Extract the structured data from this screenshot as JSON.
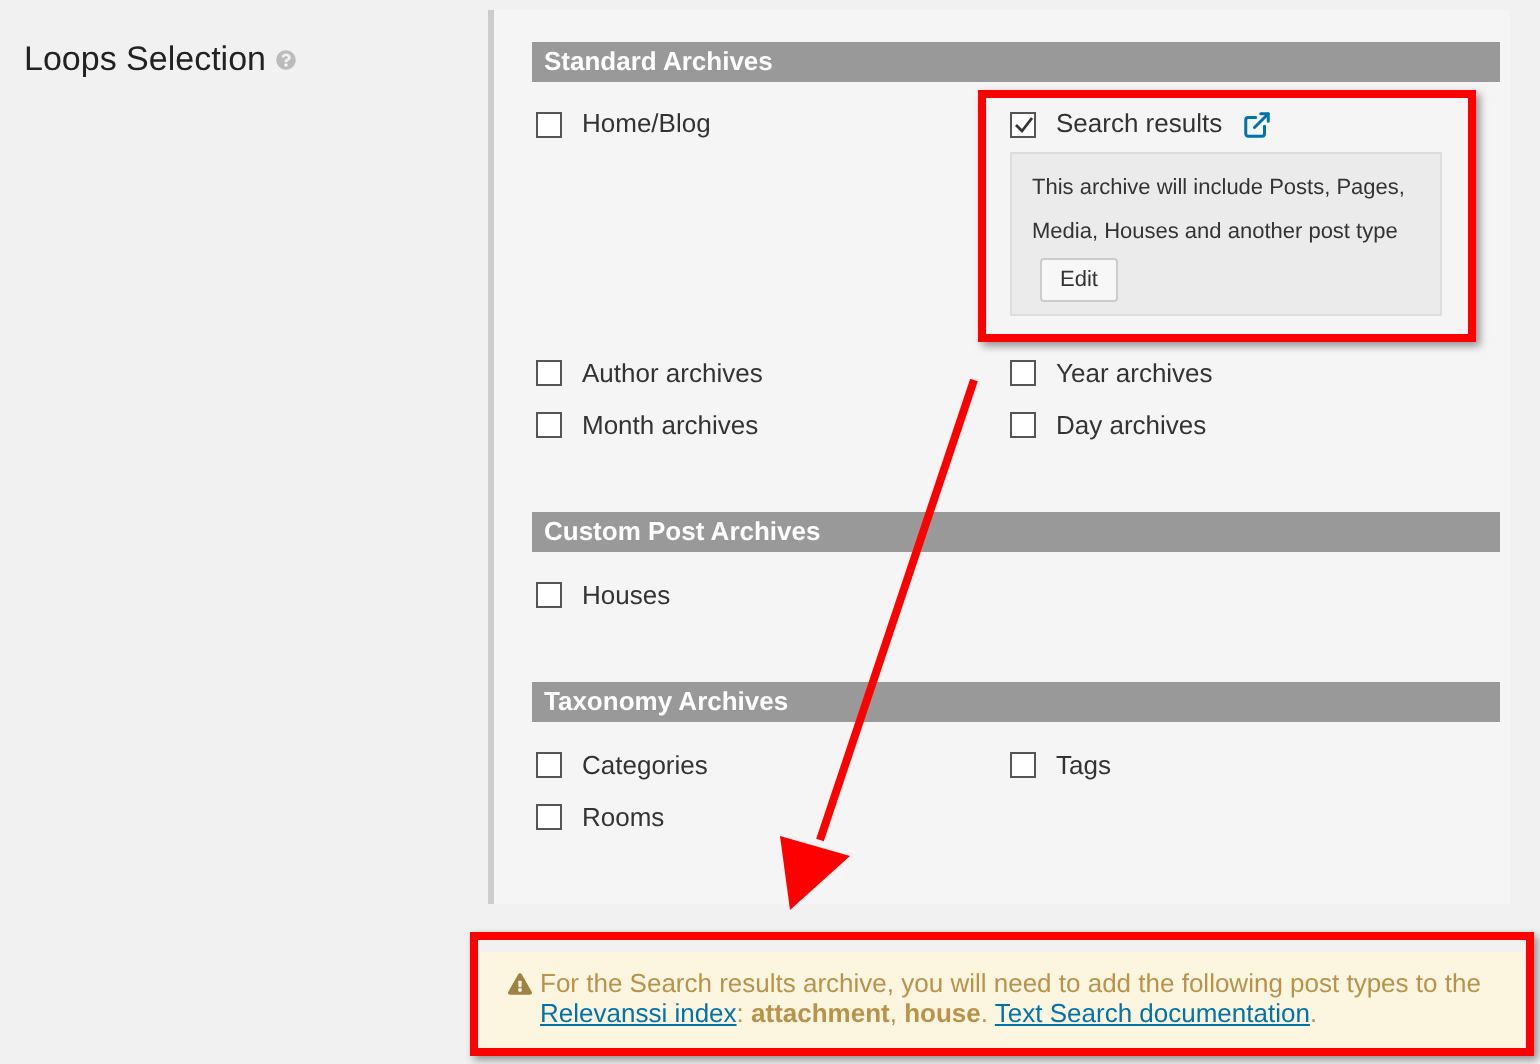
{
  "setting": {
    "label": "Loops Selection"
  },
  "sections": [
    {
      "title": "Standard Archives",
      "items": [
        {
          "label": "Home/Blog",
          "checked": false
        },
        {
          "label": "Search results",
          "checked": true,
          "link": true,
          "note": {
            "text": "This archive will include Posts, Pages, Media, Houses and another post type",
            "button": "Edit"
          }
        },
        {
          "label": "Author archives",
          "checked": false
        },
        {
          "label": "Year archives",
          "checked": false
        },
        {
          "label": "Month archives",
          "checked": false
        },
        {
          "label": "Day archives",
          "checked": false
        }
      ]
    },
    {
      "title": "Custom Post Archives",
      "items": [
        {
          "label": "Houses",
          "checked": false
        }
      ]
    },
    {
      "title": "Taxonomy Archives",
      "items": [
        {
          "label": "Categories",
          "checked": false
        },
        {
          "label": "Tags",
          "checked": false
        },
        {
          "label": "Rooms",
          "checked": false
        }
      ]
    }
  ],
  "notice": {
    "parts": [
      {
        "kind": "text",
        "text": "For the Search results archive, you will need to add the following post types to the "
      },
      {
        "kind": "link",
        "text": "Relevanssi index"
      },
      {
        "kind": "text",
        "text": ": **attachment**, **house**. "
      },
      {
        "kind": "link",
        "text": "Text Search documentation"
      },
      {
        "kind": "text",
        "text": "."
      }
    ]
  }
}
